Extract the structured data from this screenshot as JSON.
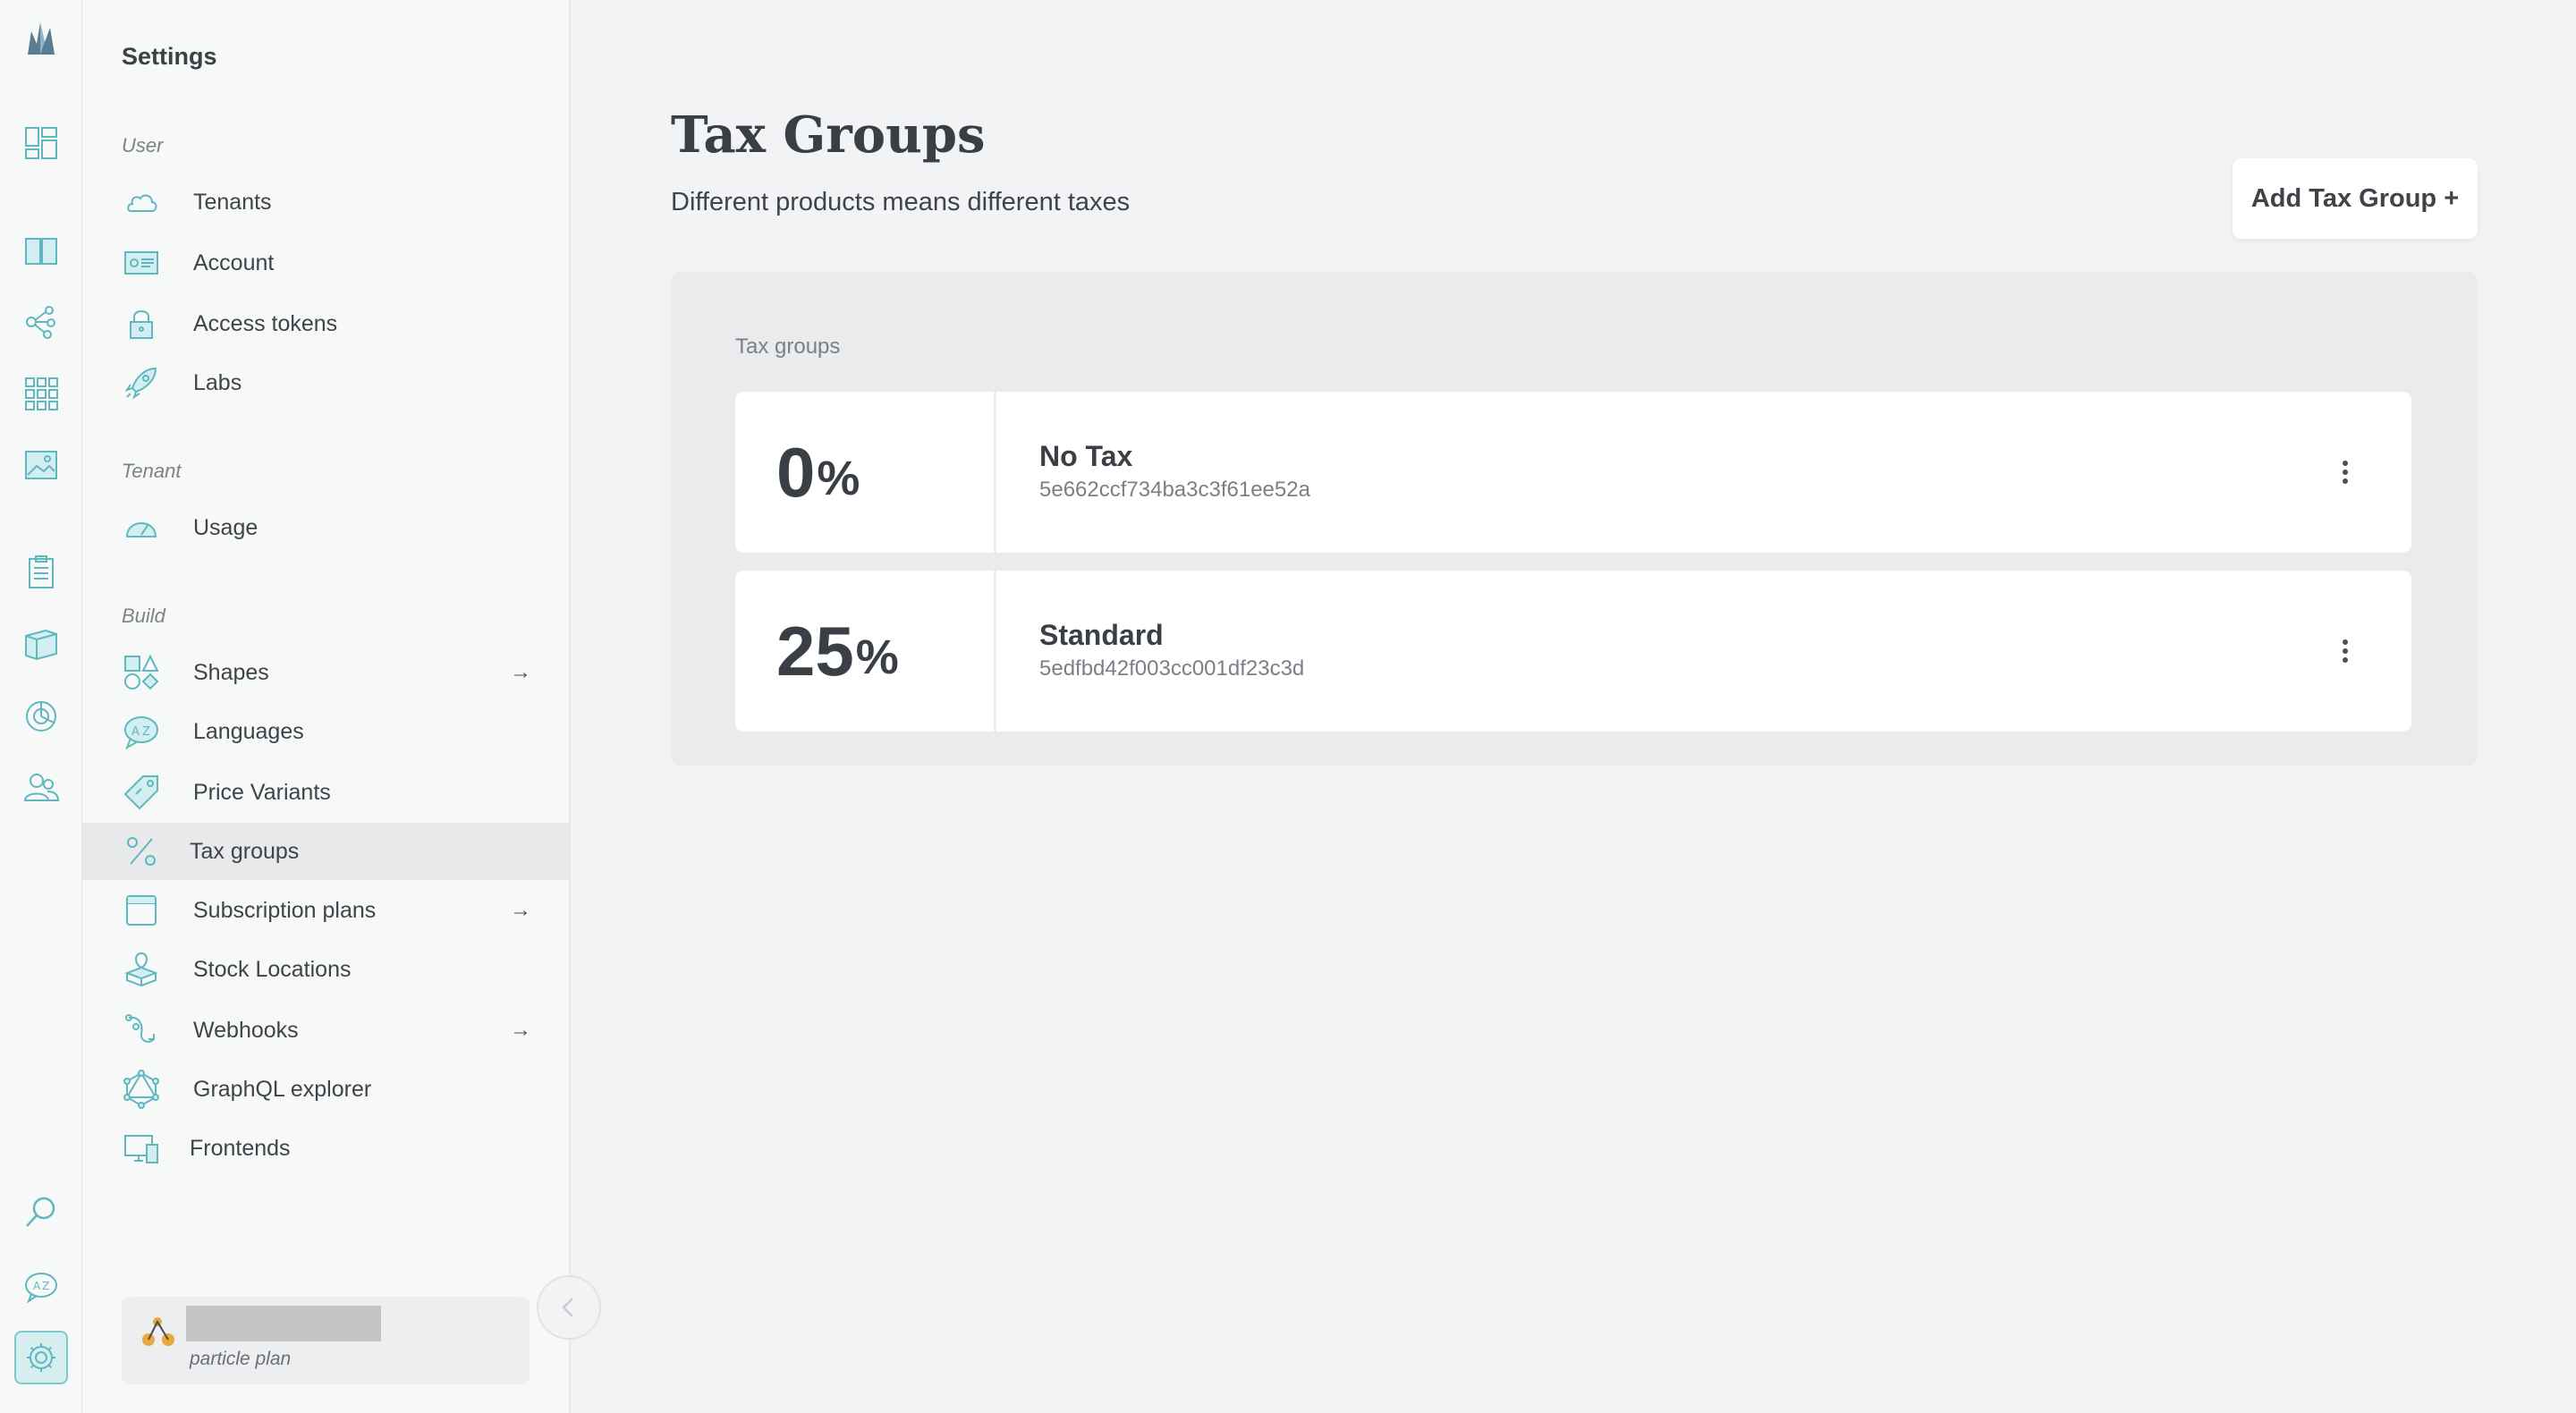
{
  "colors": {
    "accent": "#5fb8bf",
    "selected_bg": "#e8e9ea",
    "plan_accent": "#e8a83a"
  },
  "rail": {
    "items": [
      {
        "icon": "logo-icon"
      },
      {
        "icon": "dashboard-icon"
      },
      {
        "icon": "catalogue-book-icon"
      },
      {
        "icon": "topics-graph-icon"
      },
      {
        "icon": "grid-apps-icon"
      },
      {
        "icon": "image-gallery-icon"
      },
      {
        "icon": "orders-clipboard-icon"
      },
      {
        "icon": "product-box-icon"
      },
      {
        "icon": "pie-chart-icon"
      },
      {
        "icon": "customers-icon"
      },
      {
        "icon": "search-icon"
      },
      {
        "icon": "language-icon"
      },
      {
        "icon": "settings-gear-icon"
      }
    ]
  },
  "sidebar": {
    "title": "Settings",
    "sections": {
      "user": "User",
      "tenant": "Tenant",
      "build": "Build"
    },
    "items": [
      {
        "label": "Tenants",
        "icon": "cloud-icon"
      },
      {
        "label": "Account",
        "icon": "id-card-icon"
      },
      {
        "label": "Access tokens",
        "icon": "lock-icon"
      },
      {
        "label": "Labs",
        "icon": "rocket-icon"
      },
      {
        "label": "Usage",
        "icon": "gauge-icon"
      },
      {
        "label": "Shapes",
        "icon": "shapes-icon",
        "arrow": "→"
      },
      {
        "label": "Languages",
        "icon": "language-bubble-icon"
      },
      {
        "label": "Price Variants",
        "icon": "price-tag-icon"
      },
      {
        "label": "Tax groups",
        "icon": "percent-icon"
      },
      {
        "label": "Subscription plans",
        "icon": "calendar-icon",
        "arrow": "→"
      },
      {
        "label": "Stock Locations",
        "icon": "warehouse-icon"
      },
      {
        "label": "Webhooks",
        "icon": "webhook-icon",
        "arrow": "→"
      },
      {
        "label": "GraphQL explorer",
        "icon": "graphql-icon"
      },
      {
        "label": "Frontends",
        "icon": "devices-icon"
      }
    ],
    "plan": {
      "name": "particle plan",
      "icon": "particle-icon"
    }
  },
  "main": {
    "title": "Tax Groups",
    "subtitle": "Different products means different taxes",
    "add_button": "Add Tax Group +",
    "list_label": "Tax groups",
    "groups": [
      {
        "rate": "0",
        "symbol": "%",
        "name": "No Tax",
        "id": "5e662ccf734ba3c3f61ee52a"
      },
      {
        "rate": "25",
        "symbol": "%",
        "name": "Standard",
        "id": "5edfbd42f003cc001df23c3d"
      }
    ]
  }
}
